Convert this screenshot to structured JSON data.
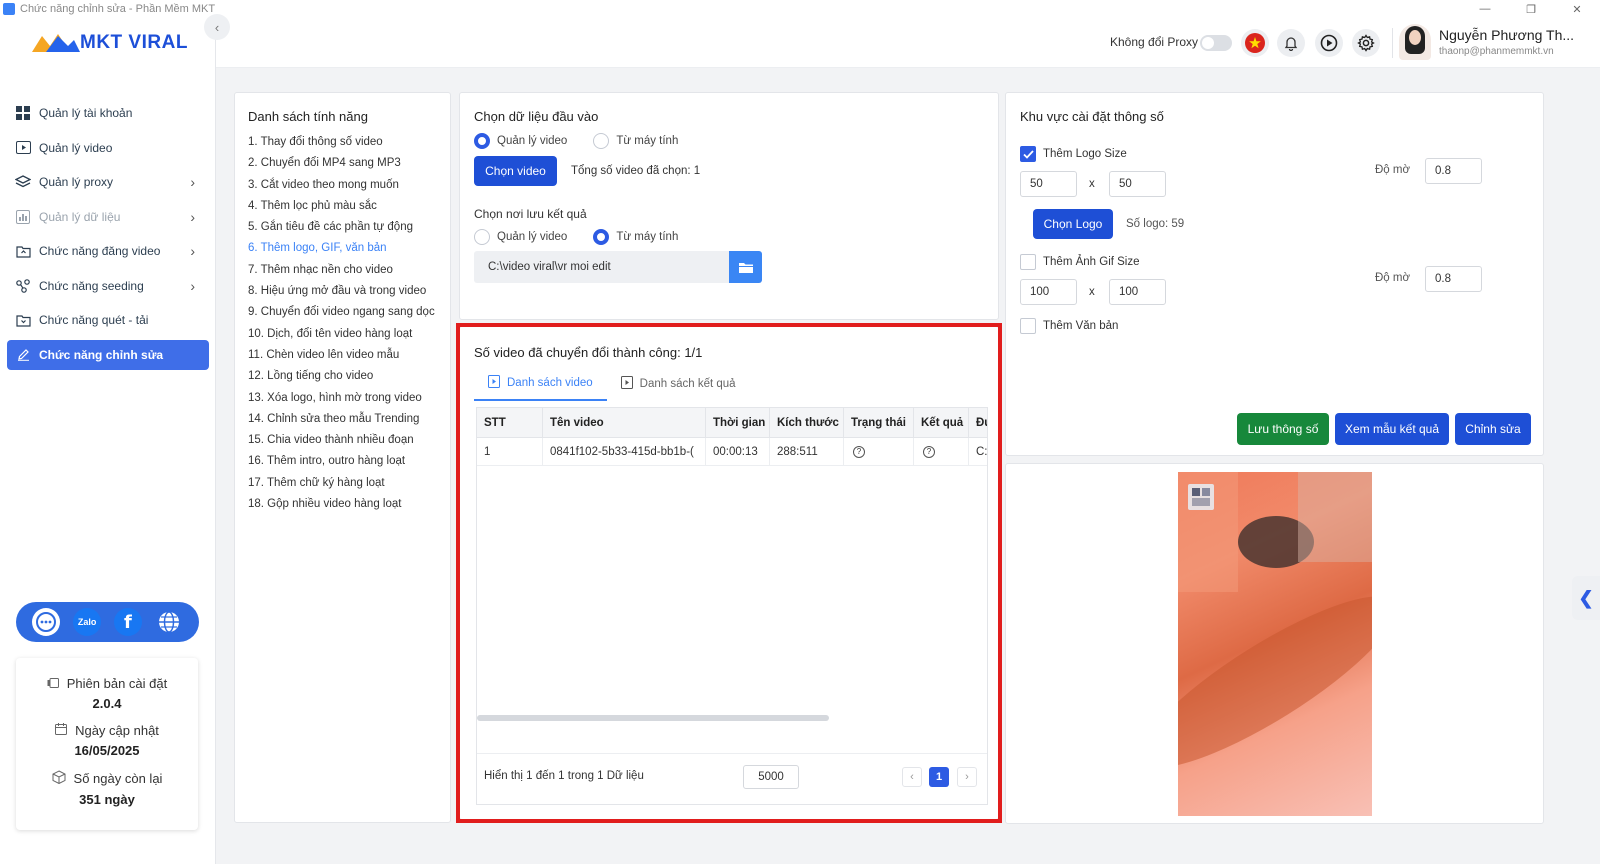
{
  "window": {
    "title": "Chức năng chỉnh sửa - Phần Mềm MKT",
    "minimize": "—",
    "restore": "❐",
    "close": "✕"
  },
  "brand": {
    "name": "MKT VIRAL"
  },
  "sidebar": {
    "items": [
      {
        "label": "Quản lý tài khoản",
        "icon": "grid-icon"
      },
      {
        "label": "Quản lý video",
        "icon": "video-icon"
      },
      {
        "label": "Quản lý proxy",
        "icon": "layers-icon",
        "chevron": "›"
      },
      {
        "label": "Quản lý dữ liệu",
        "icon": "chart-icon",
        "chevron": "›"
      },
      {
        "label": "Chức năng đăng video",
        "icon": "upload-icon",
        "chevron": "›"
      },
      {
        "label": "Chức năng seeding",
        "icon": "share-icon",
        "chevron": "›"
      },
      {
        "label": "Chức năng quét - tải",
        "icon": "download-icon"
      },
      {
        "label": "Chức năng chỉnh sửa",
        "icon": "edit-icon"
      }
    ],
    "social": {
      "zalo": "Zalo",
      "facebook": "f"
    },
    "version": {
      "install_label": "Phiên bản cài đặt",
      "install_value": "2.0.4",
      "update_label": "Ngày cập nhật",
      "update_value": "16/05/2025",
      "remaining_label": "Số ngày còn lại",
      "remaining_value": "351 ngày"
    }
  },
  "header": {
    "proxy_label": "Không đổi Proxy",
    "proxy_toggle_on": false,
    "user_name": "Nguyễn Phương Th...",
    "user_email": "thaonp@phanmemmkt.vn"
  },
  "features": {
    "title": "Danh sách tính năng",
    "items": [
      "1. Thay đổi thông số video",
      "2. Chuyển đổi MP4 sang MP3",
      "3. Cắt video theo mong muốn",
      "4. Thêm lọc phủ màu sắc",
      "5. Gắn tiêu đề các phần tự động",
      "6. Thêm logo, GIF, văn bản",
      "7. Thêm nhạc nền cho video",
      "8. Hiệu ứng mở đầu và trong video",
      "9. Chuyển đổi video ngang sang dọc",
      "10. Dịch, đổi tên video hàng loạt",
      "11. Chèn video lên video mẫu",
      "12. Lồng tiếng cho video",
      "13. Xóa logo, hình mờ trong video",
      "14. Chỉnh sửa theo mẫu Trending",
      "15. Chia video thành nhiều đoạn",
      "16. Thêm intro, outro hàng loạt",
      "17. Thêm chữ ký hàng loạt",
      "18. Gộp nhiều video hàng loạt"
    ],
    "active_index": 5
  },
  "input": {
    "title": "Chọn dữ liệu đầu vào",
    "option_manage": "Quản lý video",
    "option_computer": "Từ máy tính",
    "choose_button": "Chọn video",
    "total_selected": "Tổng số video đã chọn: 1",
    "output_title": "Chọn nơi lưu kết quả",
    "output_manage": "Quản lý video",
    "output_computer": "Từ máy tính",
    "output_path": "C:\\video viral\\vr moi edit"
  },
  "results": {
    "title": "Số video đã chuyển đổi thành công: 1/1",
    "tab_videos": "Danh sách video",
    "tab_results": "Danh sách kết quả",
    "columns": [
      "STT",
      "Tên video",
      "Thời gian",
      "Kích thước",
      "Trạng thái",
      "Kết quả",
      "Đư"
    ],
    "rows": [
      [
        "1",
        "0841f102-5b33-415d-bb1b-(",
        "00:00:13",
        "288:511",
        "?",
        "?",
        "C:"
      ]
    ],
    "footer_text": "Hiển thị 1 đến 1 trong 1 Dữ liệu",
    "page_size": "5000",
    "prev": "‹",
    "next": "›",
    "current_page": "1"
  },
  "settings": {
    "title": "Khu vực cài đặt thông số",
    "logo_label": "Thêm Logo Size",
    "logo_checked": true,
    "logo_w": "50",
    "logo_h": "50",
    "opacity_label": "Độ mờ",
    "logo_opacity": "0.8",
    "choose_logo_button": "Chọn Logo",
    "logo_count": "Số logo: 59",
    "gif_label": "Thêm Ảnh Gif Size",
    "gif_w": "100",
    "gif_h": "100",
    "gif_opacity": "0.8",
    "text_label": "Thêm Văn bản",
    "times": "x",
    "save_button": "Lưu thông số",
    "preview_button": "Xem mẫu kết quả",
    "edit_button": "Chỉnh sửa"
  },
  "colors": {
    "primary": "#1e4fd6",
    "accent": "#3b82f6",
    "green": "#17883b",
    "highlight": "#e11d1d"
  }
}
